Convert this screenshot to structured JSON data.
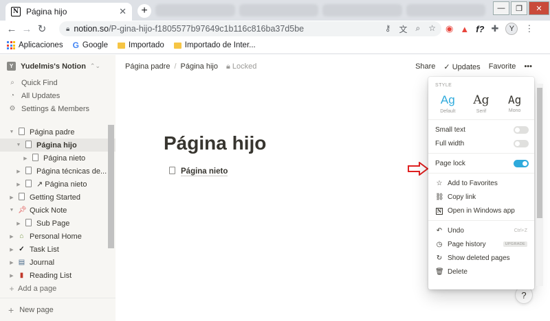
{
  "browser": {
    "tab_title": "Página hijo",
    "url_host": "notion.so",
    "url_path": "/P-gina-hijo-f1805577b97649c1b116c816ba37d5be",
    "bookmarks": [
      "Aplicaciones",
      "Google",
      "Importado",
      "Importado de Inter..."
    ],
    "avatar_letter": "Y",
    "new_tab_symbol": "+",
    "tab_close_symbol": "✕",
    "window_controls": [
      "—",
      "❐",
      "✕"
    ]
  },
  "sidebar": {
    "workspace_icon_letter": "Y",
    "workspace_name": "Yudelmis's Notion",
    "top_items": [
      {
        "label": "Quick Find",
        "icon": "search-icon"
      },
      {
        "label": "All Updates",
        "icon": "clock-icon"
      },
      {
        "label": "Settings & Members",
        "icon": "gear-icon"
      }
    ],
    "tree": [
      {
        "label": "Página padre",
        "depth": 0,
        "expanded": true,
        "icon": "page-icon"
      },
      {
        "label": "Página hijo",
        "depth": 1,
        "expanded": true,
        "icon": "page-icon",
        "active": true
      },
      {
        "label": "Página nieto",
        "depth": 2,
        "expanded": false,
        "icon": "page-icon"
      },
      {
        "label": "Página técnicas de...",
        "depth": 1,
        "expanded": false,
        "icon": "page-icon"
      },
      {
        "label": "↗ Página nieto",
        "depth": 1,
        "expanded": false,
        "icon": "page-icon"
      },
      {
        "label": "Getting Started",
        "depth": 0,
        "expanded": false,
        "icon": "page-icon"
      },
      {
        "label": "Quick Note",
        "depth": 0,
        "expanded": true,
        "icon": "pin-icon"
      },
      {
        "label": "Sub Page",
        "depth": 1,
        "expanded": false,
        "icon": "page-icon"
      },
      {
        "label": "Personal Home",
        "depth": 0,
        "expanded": false,
        "icon": "house-icon"
      },
      {
        "label": "Task List",
        "depth": 0,
        "expanded": false,
        "icon": "check-icon"
      },
      {
        "label": "Journal",
        "depth": 0,
        "expanded": false,
        "icon": "notebook-icon"
      },
      {
        "label": "Reading List",
        "depth": 0,
        "expanded": false,
        "icon": "book-icon"
      }
    ],
    "add_page": "Add a page",
    "new_page": "New page"
  },
  "topbar": {
    "breadcrumb_parent": "Página padre",
    "breadcrumb_separator": "/",
    "breadcrumb_current": "Página hijo",
    "locked_label": "Locked",
    "share": "Share",
    "updates": "Updates",
    "favorite": "Favorite",
    "more": "•••"
  },
  "page": {
    "title": "Página hijo",
    "subpage_link": "Página nieto",
    "help": "?"
  },
  "menu": {
    "style_header": "STYLE",
    "styles": [
      {
        "glyph": "Ag",
        "name": "Default",
        "selected": true
      },
      {
        "glyph": "Ag",
        "name": "Serif",
        "selected": false
      },
      {
        "glyph": "Ag",
        "name": "Mono",
        "selected": false
      }
    ],
    "small_text": {
      "label": "Small text",
      "on": false
    },
    "full_width": {
      "label": "Full width",
      "on": false
    },
    "page_lock": {
      "label": "Page lock",
      "on": true
    },
    "actions": [
      {
        "label": "Add to Favorites",
        "icon": "star-icon"
      },
      {
        "label": "Copy link",
        "icon": "link-icon"
      },
      {
        "label": "Open in Windows app",
        "icon": "notion-icon"
      }
    ],
    "undo": {
      "label": "Undo",
      "shortcut": "Ctrl+Z"
    },
    "page_history": {
      "label": "Page history",
      "badge": "UPGRADE"
    },
    "show_deleted": "Show deleted pages",
    "delete": "Delete"
  },
  "colors": {
    "accent": "#2eaadc",
    "annotation_arrow": "#e02020",
    "sidebar_bg": "#f7f6f3"
  }
}
